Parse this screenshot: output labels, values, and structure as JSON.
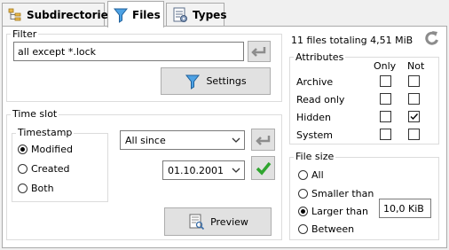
{
  "tabs": [
    {
      "label": "Subdirectories",
      "icon": "tree-icon"
    },
    {
      "label": "Files",
      "icon": "funnel-icon"
    },
    {
      "label": "Types",
      "icon": "document-settings-icon"
    }
  ],
  "filter": {
    "group_label": "Filter",
    "value": "all except *.lock",
    "settings_label": "Settings"
  },
  "summary": "11 files totaling 4,51 MiB",
  "attributes": {
    "group_label": "Attributes",
    "col_only": "Only",
    "col_not": "Not",
    "rows": [
      {
        "label": "Archive",
        "only": false,
        "not": false
      },
      {
        "label": "Read only",
        "only": false,
        "not": false
      },
      {
        "label": "Hidden",
        "only": false,
        "not": true
      },
      {
        "label": "System",
        "only": false,
        "not": false
      }
    ]
  },
  "time_slot": {
    "group_label": "Time slot",
    "timestamp_label": "Timestamp",
    "timestamp_options": [
      "Modified",
      "Created",
      "Both"
    ],
    "timestamp_selected": "Modified",
    "range_value": "All since",
    "date_value": "01.10.2001",
    "preview_label": "Preview"
  },
  "file_size": {
    "group_label": "File size",
    "options": [
      "All",
      "Smaller than",
      "Larger than",
      "Between"
    ],
    "selected": "Larger than",
    "size_value": "10,0 KiB"
  },
  "colors": {
    "accent_green": "#2fa52f",
    "funnel_blue": "#3a8ed6"
  }
}
